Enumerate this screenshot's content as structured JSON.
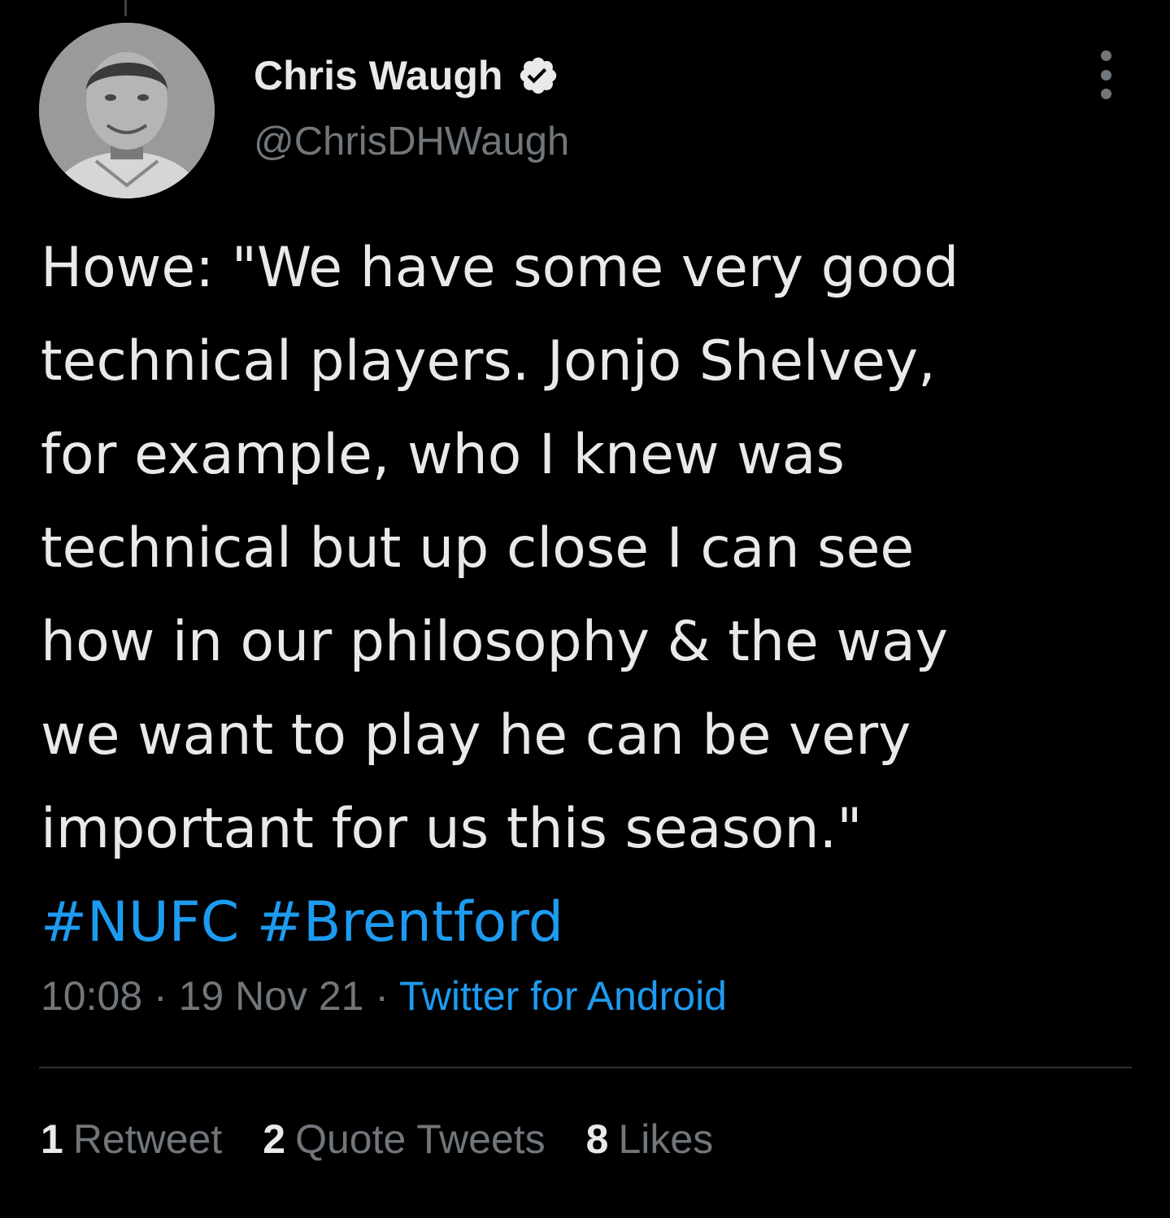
{
  "author": {
    "display_name": "Chris Waugh",
    "handle": "@ChrisDHWaugh",
    "verified": true
  },
  "tweet": {
    "lines": [
      "Howe: \"We have some very good",
      "technical players. Jonjo Shelvey,",
      "for example, who I knew was",
      "technical but up close I can see",
      "how in our philosophy & the way",
      "we want to play he can be very",
      "important for us this season.\""
    ],
    "hashtags": [
      "#NUFC",
      "#Brentford"
    ]
  },
  "meta": {
    "time": "10:08",
    "separator1": " · ",
    "date": "19 Nov 21",
    "separator2": " · ",
    "source": "Twitter for Android"
  },
  "stats": {
    "retweets_count": "1",
    "retweets_label": "Retweet",
    "quotes_count": "2",
    "quotes_label": "Quote Tweets",
    "likes_count": "8",
    "likes_label": "Likes"
  },
  "colors": {
    "background": "#000000",
    "text": "#e7e9ea",
    "secondary": "#71767b",
    "accent": "#1d9bf0",
    "divider": "#2f3336"
  },
  "icons": {
    "verified": "verified-badge-icon",
    "more": "more-options-icon"
  }
}
